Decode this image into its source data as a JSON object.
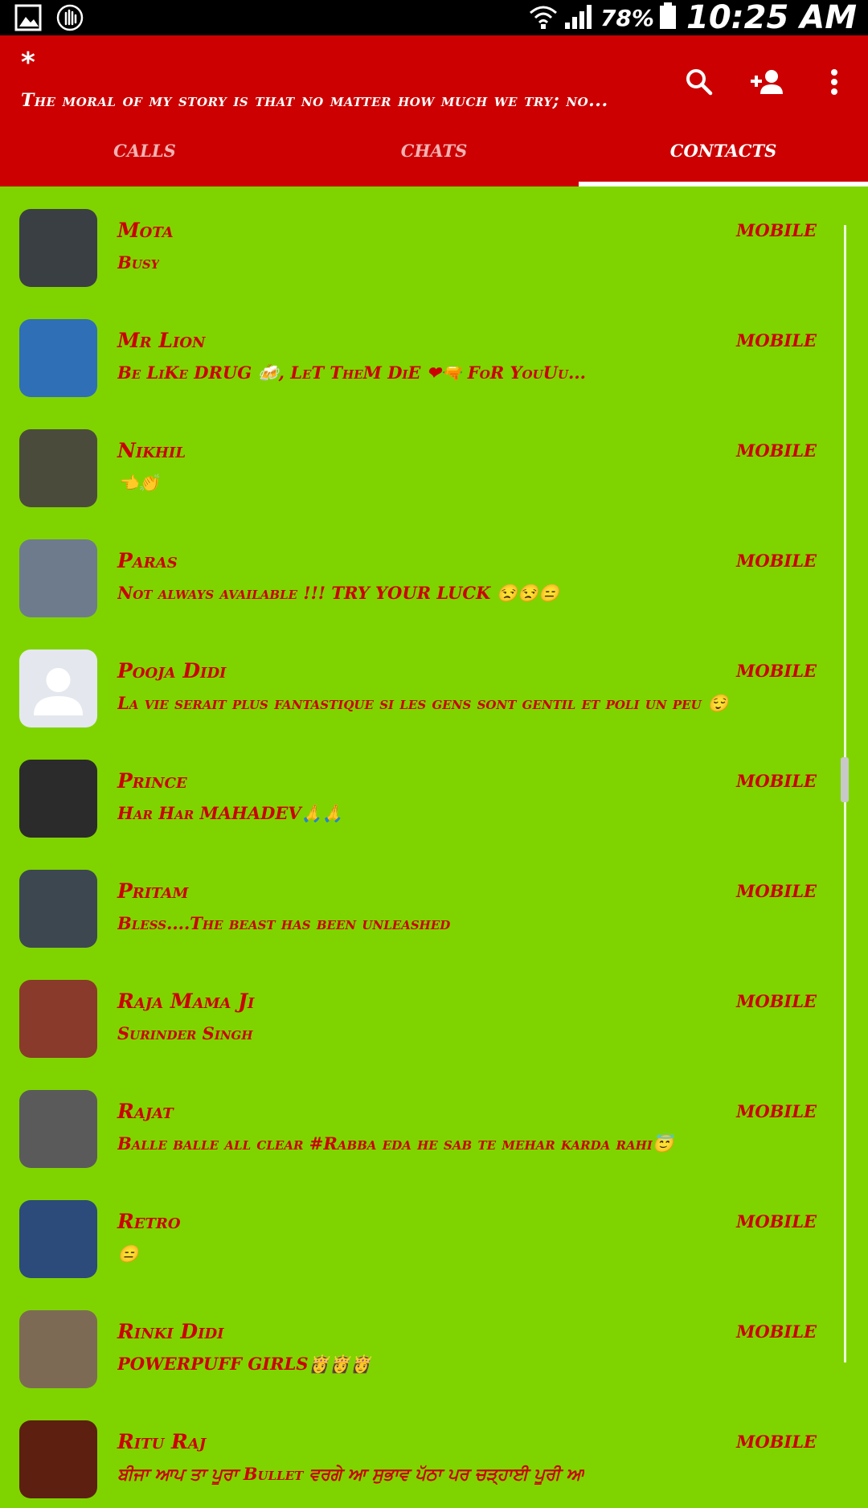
{
  "status_bar": {
    "battery_percent": "78%",
    "time": "10:25 AM",
    "icons": [
      "gallery-icon",
      "hand-icon",
      "wifi-icon",
      "signal-icon",
      "battery-icon"
    ]
  },
  "header": {
    "title": "*",
    "subtitle": "The moral of my story is that no matter how much we try; no...",
    "actions": [
      "search-icon",
      "add-contact-icon",
      "more-vert-icon"
    ]
  },
  "tabs": [
    {
      "label": "CALLS",
      "active": false
    },
    {
      "label": "CHATS",
      "active": false
    },
    {
      "label": "CONTACTS",
      "active": true
    }
  ],
  "contacts": [
    {
      "name": "Mota",
      "status": "Busy",
      "type": "MOBILE",
      "avatar_color": "#3a3f44"
    },
    {
      "name": "Mr Lion",
      "status": "Be LiKe DRUG 🍻, LeT TheM DiE ❤🔫 FoR YouUu...",
      "type": "MOBILE",
      "avatar_color": "#2f6fb5"
    },
    {
      "name": "Nikhil",
      "status": "👈👏",
      "type": "MOBILE",
      "avatar_color": "#4b4b3c"
    },
    {
      "name": "Paras",
      "status": "Not always available !!! TRY YOUR LUCK 😒😒😑",
      "type": "MOBILE",
      "avatar_color": "#6e7b8c"
    },
    {
      "name": "Pooja Didi",
      "status": "La vie serait plus fantastique si les gens sont gentil et poli un peu 😌",
      "type": "MOBILE",
      "avatar_color": "#e4e8ee"
    },
    {
      "name": "Prince",
      "status": "Har Har MAHADEV🙏🙏",
      "type": "MOBILE",
      "avatar_color": "#2b2b2b"
    },
    {
      "name": "Pritam",
      "status": "Bless....The beast has been unleashed",
      "type": "MOBILE",
      "avatar_color": "#3c4750"
    },
    {
      "name": "Raja Mama Ji",
      "status": "Surinder Singh",
      "type": "MOBILE",
      "avatar_color": "#8a3a2a"
    },
    {
      "name": "Rajat",
      "status": "Balle balle all clear #Rabba eda he sab te mehar karda rahi😇",
      "type": "MOBILE",
      "avatar_color": "#5a5a5a"
    },
    {
      "name": "Retro",
      "status": "😑",
      "type": "MOBILE",
      "avatar_color": "#2c4a7a"
    },
    {
      "name": "Rinki Didi",
      "status": "POWERPUFF GIRLS👸👸👸",
      "type": "MOBILE",
      "avatar_color": "#7d6a55"
    },
    {
      "name": "Ritu Raj",
      "status": "ਬੀਜਾ ਆਪ ਤਾ ਪੂਰਾ Bullet ਵਰਗੇ ਆ ਸੁਭਾਵ ਪੱਠਾ ਪਰ ਚੜ੍ਹਾਈ ਪੂਰੀ ਆ",
      "type": "MOBILE",
      "avatar_color": "#5c1f10"
    }
  ]
}
